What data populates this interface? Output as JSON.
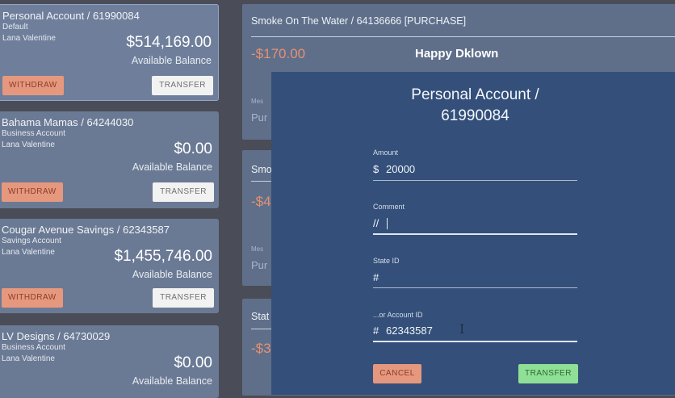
{
  "accounts": [
    {
      "title": "Personal Account / 61990084",
      "type": "Default",
      "holder": "Lana Valentine",
      "balance": "$514,169.00",
      "avail_label": "Available Balance",
      "withdraw": "WITHDRAW",
      "transfer": "TRANSFER"
    },
    {
      "title": "Bahama Mamas / 64244030",
      "type": "Business Account",
      "holder": "Lana Valentine",
      "balance": "$0.00",
      "avail_label": "Available Balance",
      "withdraw": "WITHDRAW",
      "transfer": "TRANSFER"
    },
    {
      "title": "Cougar Avenue Savings / 62343587",
      "type": "Savings Account",
      "holder": "Lana Valentine",
      "balance": "$1,455,746.00",
      "avail_label": "Available Balance",
      "withdraw": "WITHDRAW",
      "transfer": "TRANSFER"
    },
    {
      "title": "LV Designs / 64730029",
      "type": "Business Account",
      "holder": "Lana Valentine",
      "balance": "$0.00",
      "avail_label": "Available Balance"
    }
  ],
  "transactions": [
    {
      "title": "Smoke On The Water / 64136666 [PURCHASE]",
      "amount": "-$170.00",
      "name": "Happy Dklown",
      "msg_label": "Mes",
      "msg": "Pur"
    },
    {
      "title": "Smo",
      "amount": "-$4",
      "msg_label": "Mes",
      "msg": "Pur"
    },
    {
      "title": "Stat",
      "amount": "-$3"
    }
  ],
  "modal": {
    "title_line1": "Personal Account /",
    "title_line2": "61990084",
    "fields": [
      {
        "label": "Amount",
        "prefix": "$",
        "value": "20000"
      },
      {
        "label": "Comment",
        "prefix": "//",
        "value": ""
      },
      {
        "label": "State ID",
        "prefix": "#",
        "value": ""
      },
      {
        "label": "...or Account ID",
        "prefix": "#",
        "value": "62343587"
      }
    ],
    "cancel": "CANCEL",
    "transfer": "TRANSFER"
  }
}
